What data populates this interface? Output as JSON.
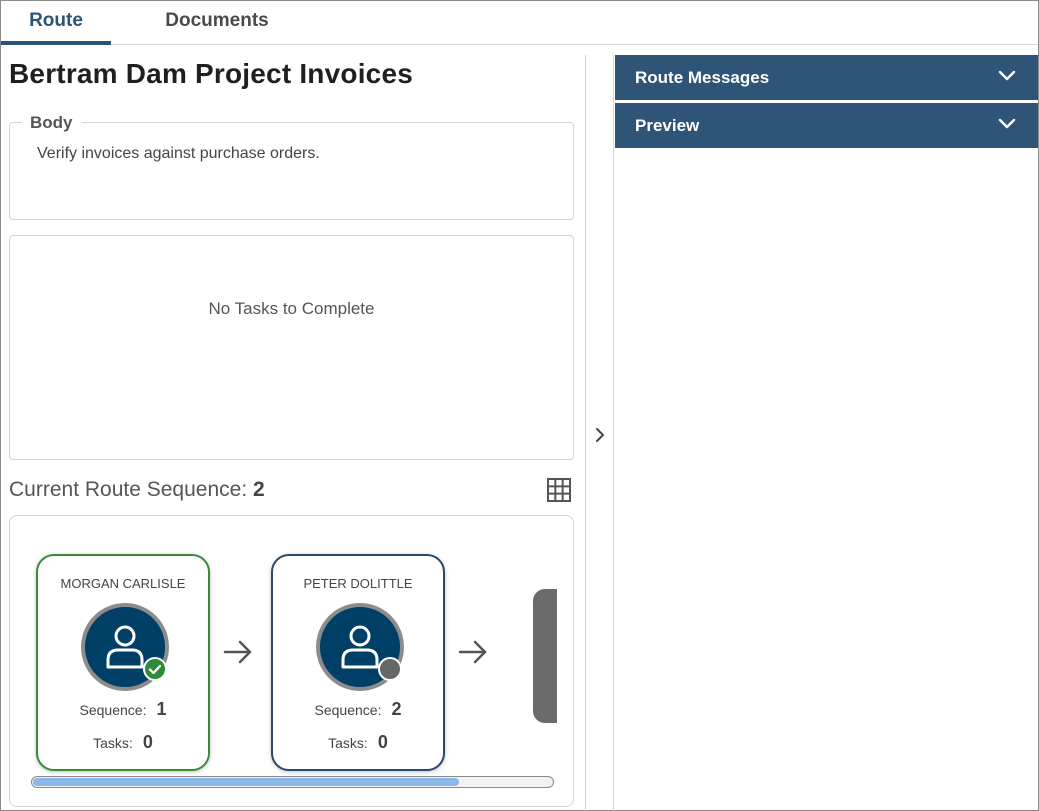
{
  "tabs": [
    {
      "label": "Route",
      "active": true
    },
    {
      "label": "Documents",
      "active": false
    }
  ],
  "page": {
    "title": "Bertram Dam Project Invoices"
  },
  "body_section": {
    "legend": "Body",
    "text": "Verify invoices against purchase orders."
  },
  "tasks": {
    "empty_message": "No Tasks to Complete"
  },
  "route_sequence": {
    "label": "Current Route Sequence:",
    "current": "2",
    "scroll_position": 0.82,
    "steps": [
      {
        "name": "MORGAN CARLISLE",
        "sequence_label": "Sequence:",
        "sequence": "1",
        "tasks_label": "Tasks:",
        "tasks": "0",
        "status": "complete"
      },
      {
        "name": "PETER DOLITTLE",
        "sequence_label": "Sequence:",
        "sequence": "2",
        "tasks_label": "Tasks:",
        "tasks": "0",
        "status": "pending"
      }
    ]
  },
  "right_panel": {
    "sections": [
      {
        "label": "Route Messages",
        "expanded": false
      },
      {
        "label": "Preview",
        "expanded": false
      }
    ]
  },
  "colors": {
    "accent": "#2e5478",
    "complete": "#2e8b3a",
    "pending": "#666666",
    "avatar": "#003f66"
  },
  "icons": [
    "grid-icon",
    "chevron-right-icon",
    "chevron-down-icon",
    "user-icon",
    "checkmark-icon",
    "arrow-right-icon"
  ]
}
